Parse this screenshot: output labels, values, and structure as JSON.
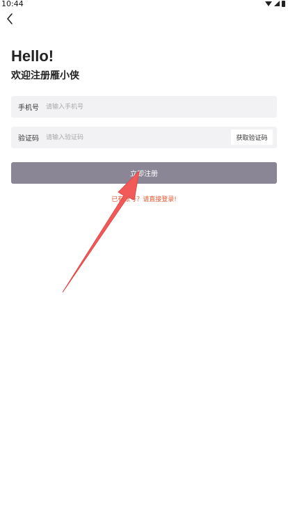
{
  "status_bar": {
    "time": "10:44"
  },
  "header": {
    "title": "Hello!",
    "subtitle": "欢迎注册雁小侠"
  },
  "form": {
    "phone": {
      "label": "手机号",
      "placeholder": "请输入手机号"
    },
    "code": {
      "label": "验证码",
      "placeholder": "请输入验证码",
      "get_code_label": "获取验证码"
    },
    "submit_label": "立即注册"
  },
  "footer": {
    "prefix": "已有账号？",
    "link": "请直接登录!"
  },
  "colors": {
    "button_bg": "#8a8696",
    "field_bg": "#f2f2f4",
    "link": "#e8552f",
    "annotation_arrow": "#f25a5a"
  },
  "icons": {
    "back": "chevron-left-icon",
    "wifi": "wifi-icon",
    "signal": "signal-icon",
    "battery": "battery-icon"
  }
}
